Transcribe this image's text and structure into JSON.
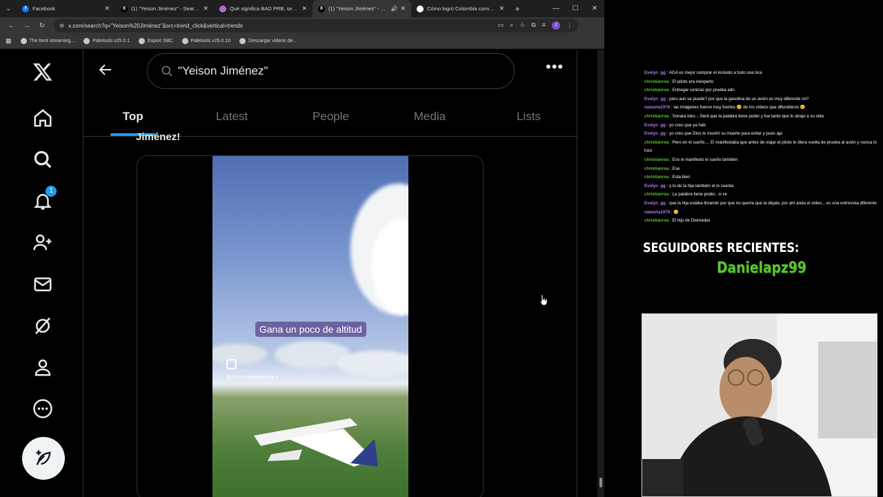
{
  "browser": {
    "tabs": [
      {
        "title": "Facebook",
        "favicon_color": "#1877f2",
        "favicon_glyph": "f",
        "active": false
      },
      {
        "title": "(1) \"Yeison Jiménez\" - Search /",
        "favicon_color": "#000000",
        "favicon_glyph": "X",
        "active": false
      },
      {
        "title": "Qué significa BAD PRB, señal q",
        "favicon_color": "#b36ad8",
        "favicon_glyph": "",
        "active": false
      },
      {
        "title": "(1) \"Yeison Jiménez\" - Search",
        "favicon_color": "#000000",
        "favicon_glyph": "X",
        "active": true
      },
      {
        "title": "Cómo logró Colombia convertir",
        "favicon_color": "#ffffff",
        "favicon_glyph": "",
        "active": false
      }
    ],
    "url": "x.com/search?q=\"Yeison%20Jiménez\"&src=trend_click&vertical=trends",
    "profile_initial": "J",
    "bookmarks": [
      "The best streaming...",
      "Paletools v25.0.1",
      "Export SBC",
      "Paletools v26.0.10",
      "Descargar videos de..."
    ]
  },
  "x": {
    "notification_count": "1",
    "search_query": "\"Yeison Jiménez\"",
    "tabs": [
      "Top",
      "Latest",
      "People",
      "Media",
      "Lists"
    ],
    "active_tab": "Top",
    "cutoff_text": "Jiménez!",
    "video": {
      "caption": "Gana un poco de altitud",
      "handle": "@ACTIVAFMPAIPA96.6"
    },
    "accent_color": "#1d9bf0"
  },
  "overlay": {
    "chat": [
      {
        "user": "Evelyn_gg",
        "color": "#b07cf0",
        "text": "AGA es mejor comprar el incluido a todo una lora"
      },
      {
        "user": "christianroa",
        "color": "#5ac631",
        "text": "El piloto era inexperto"
      },
      {
        "user": "christianroa",
        "color": "#5ac631",
        "text": "Entregar cenizas por prueba adn"
      },
      {
        "user": "Evelyn_gg",
        "color": "#b07cf0",
        "text": "pero aun se puede? por que la gasolina de un avión es muy diferente no?"
      },
      {
        "user": "natasha1976",
        "color": "#b07cf0",
        "text": "las imágenes fueron muy fuertes 😢 de los vídeos que difundieron 😢"
      },
      {
        "user": "christianroa",
        "color": "#5ac631",
        "text": "Sonara loko....Será que la palabra tiene poder y fue tanto que lo atrajo a su vida"
      },
      {
        "user": "Evelyn_gg",
        "color": "#b07cf0",
        "text": "yo creo que ya hab"
      },
      {
        "user": "Evelyn_gg",
        "color": "#b07cf0",
        "text": "yo creo que Dios le mostró su muerte para evitar y pues aja"
      },
      {
        "user": "christianroa",
        "color": "#5ac631",
        "text": "Pero en el sueño.... El manifestaba que antes de viajar el piloto le diera vuelta de prueba al avión y nunca lo hizo"
      },
      {
        "user": "christianroa",
        "color": "#5ac631",
        "text": "Eso le manifesto el sueño también"
      },
      {
        "user": "christianroa",
        "color": "#5ac631",
        "text": "Ese"
      },
      {
        "user": "christianroa",
        "color": "#5ac631",
        "text": "Esta bien"
      },
      {
        "user": "Evelyn_gg",
        "color": "#b07cf0",
        "text": "y lo de la hija también el lo cuenta"
      },
      {
        "user": "christianroa",
        "color": "#5ac631",
        "text": "La palabra tiene poder.. si ve"
      },
      {
        "user": "Evelyn_gg",
        "color": "#b07cf0",
        "text": "que la hija estaba llorando por que no quería que la déjala, por ahí anda el video... es una entrevista diferente"
      },
      {
        "user": "natasha1976",
        "color": "#b07cf0",
        "text": "😊"
      },
      {
        "user": "christianroa",
        "color": "#5ac631",
        "text": "El hijo de Diomedes"
      }
    ],
    "followers_title": "SEGUIDORES RECIENTES:",
    "recent_follower": "Danielapz99"
  }
}
